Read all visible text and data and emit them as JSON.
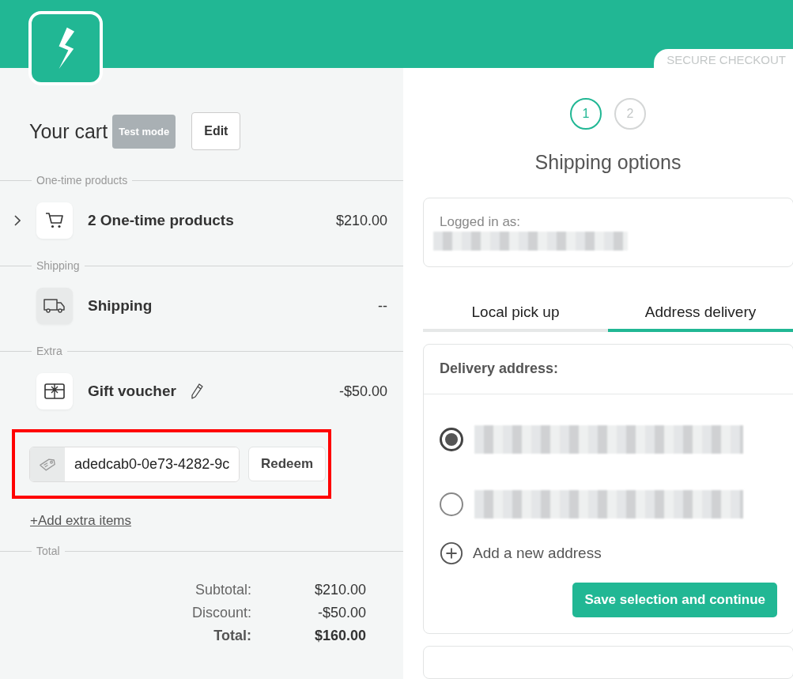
{
  "header": {
    "badge": "SECURE CHECKOUT"
  },
  "cart": {
    "title": "Your cart",
    "mode_badge": "Test mode",
    "edit_button": "Edit",
    "sections": [
      {
        "label": "One-time products",
        "items": [
          {
            "kind": "cart",
            "name": "2 One-time products",
            "price": "$210.00",
            "expanded": false,
            "editable": false
          }
        ]
      },
      {
        "label": "Shipping",
        "items": [
          {
            "kind": "truck",
            "name": "Shipping",
            "price": "--",
            "editable": false
          }
        ]
      },
      {
        "label": "Extra",
        "items": [
          {
            "kind": "gift",
            "name": "Gift voucher",
            "price": "-$50.00",
            "editable": true
          }
        ]
      }
    ],
    "voucher": {
      "value": "adedcab0-0e73-4282-9c",
      "button": "Redeem"
    },
    "add_link": "+Add extra items",
    "total_label": "Total",
    "totals": [
      {
        "label": "Subtotal:",
        "value": "$210.00",
        "kind": "plain"
      },
      {
        "label": "Discount:",
        "value": "-$50.00",
        "kind": "plain"
      },
      {
        "label": "Total:",
        "value": "$160.00",
        "kind": "grand"
      }
    ]
  },
  "checkout": {
    "steps": [
      {
        "label": "1",
        "selected": true
      },
      {
        "label": "2",
        "selected": false
      }
    ],
    "title": "Shipping options",
    "login_label": "Logged in as:",
    "tabs": [
      {
        "label": "Local pick up",
        "selected": false
      },
      {
        "label": "Address delivery",
        "selected": true
      }
    ],
    "delivery_title": "Delivery address:",
    "addresses": [
      {
        "selected": true
      },
      {
        "selected": false
      }
    ],
    "add_address": "Add a new address",
    "save_button": "Save selection and continue"
  }
}
